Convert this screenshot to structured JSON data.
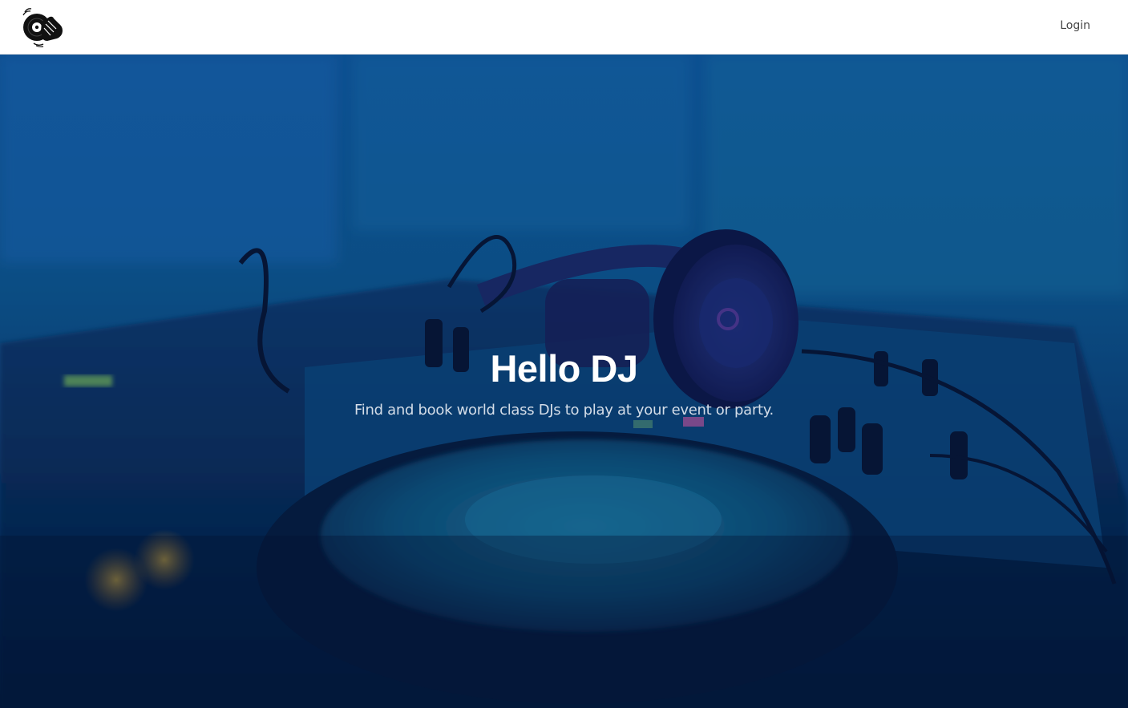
{
  "navbar": {
    "logo_icon": "dj-turntable-hand-icon",
    "login_label": "Login"
  },
  "hero": {
    "title": "Hello DJ",
    "subtitle": "Find and book world class DJs to play at your event or party.",
    "background": "dj-headphones-mixer-photo",
    "overlay_color": "#0a3a7a",
    "accent_color": "#1b4f9a"
  }
}
